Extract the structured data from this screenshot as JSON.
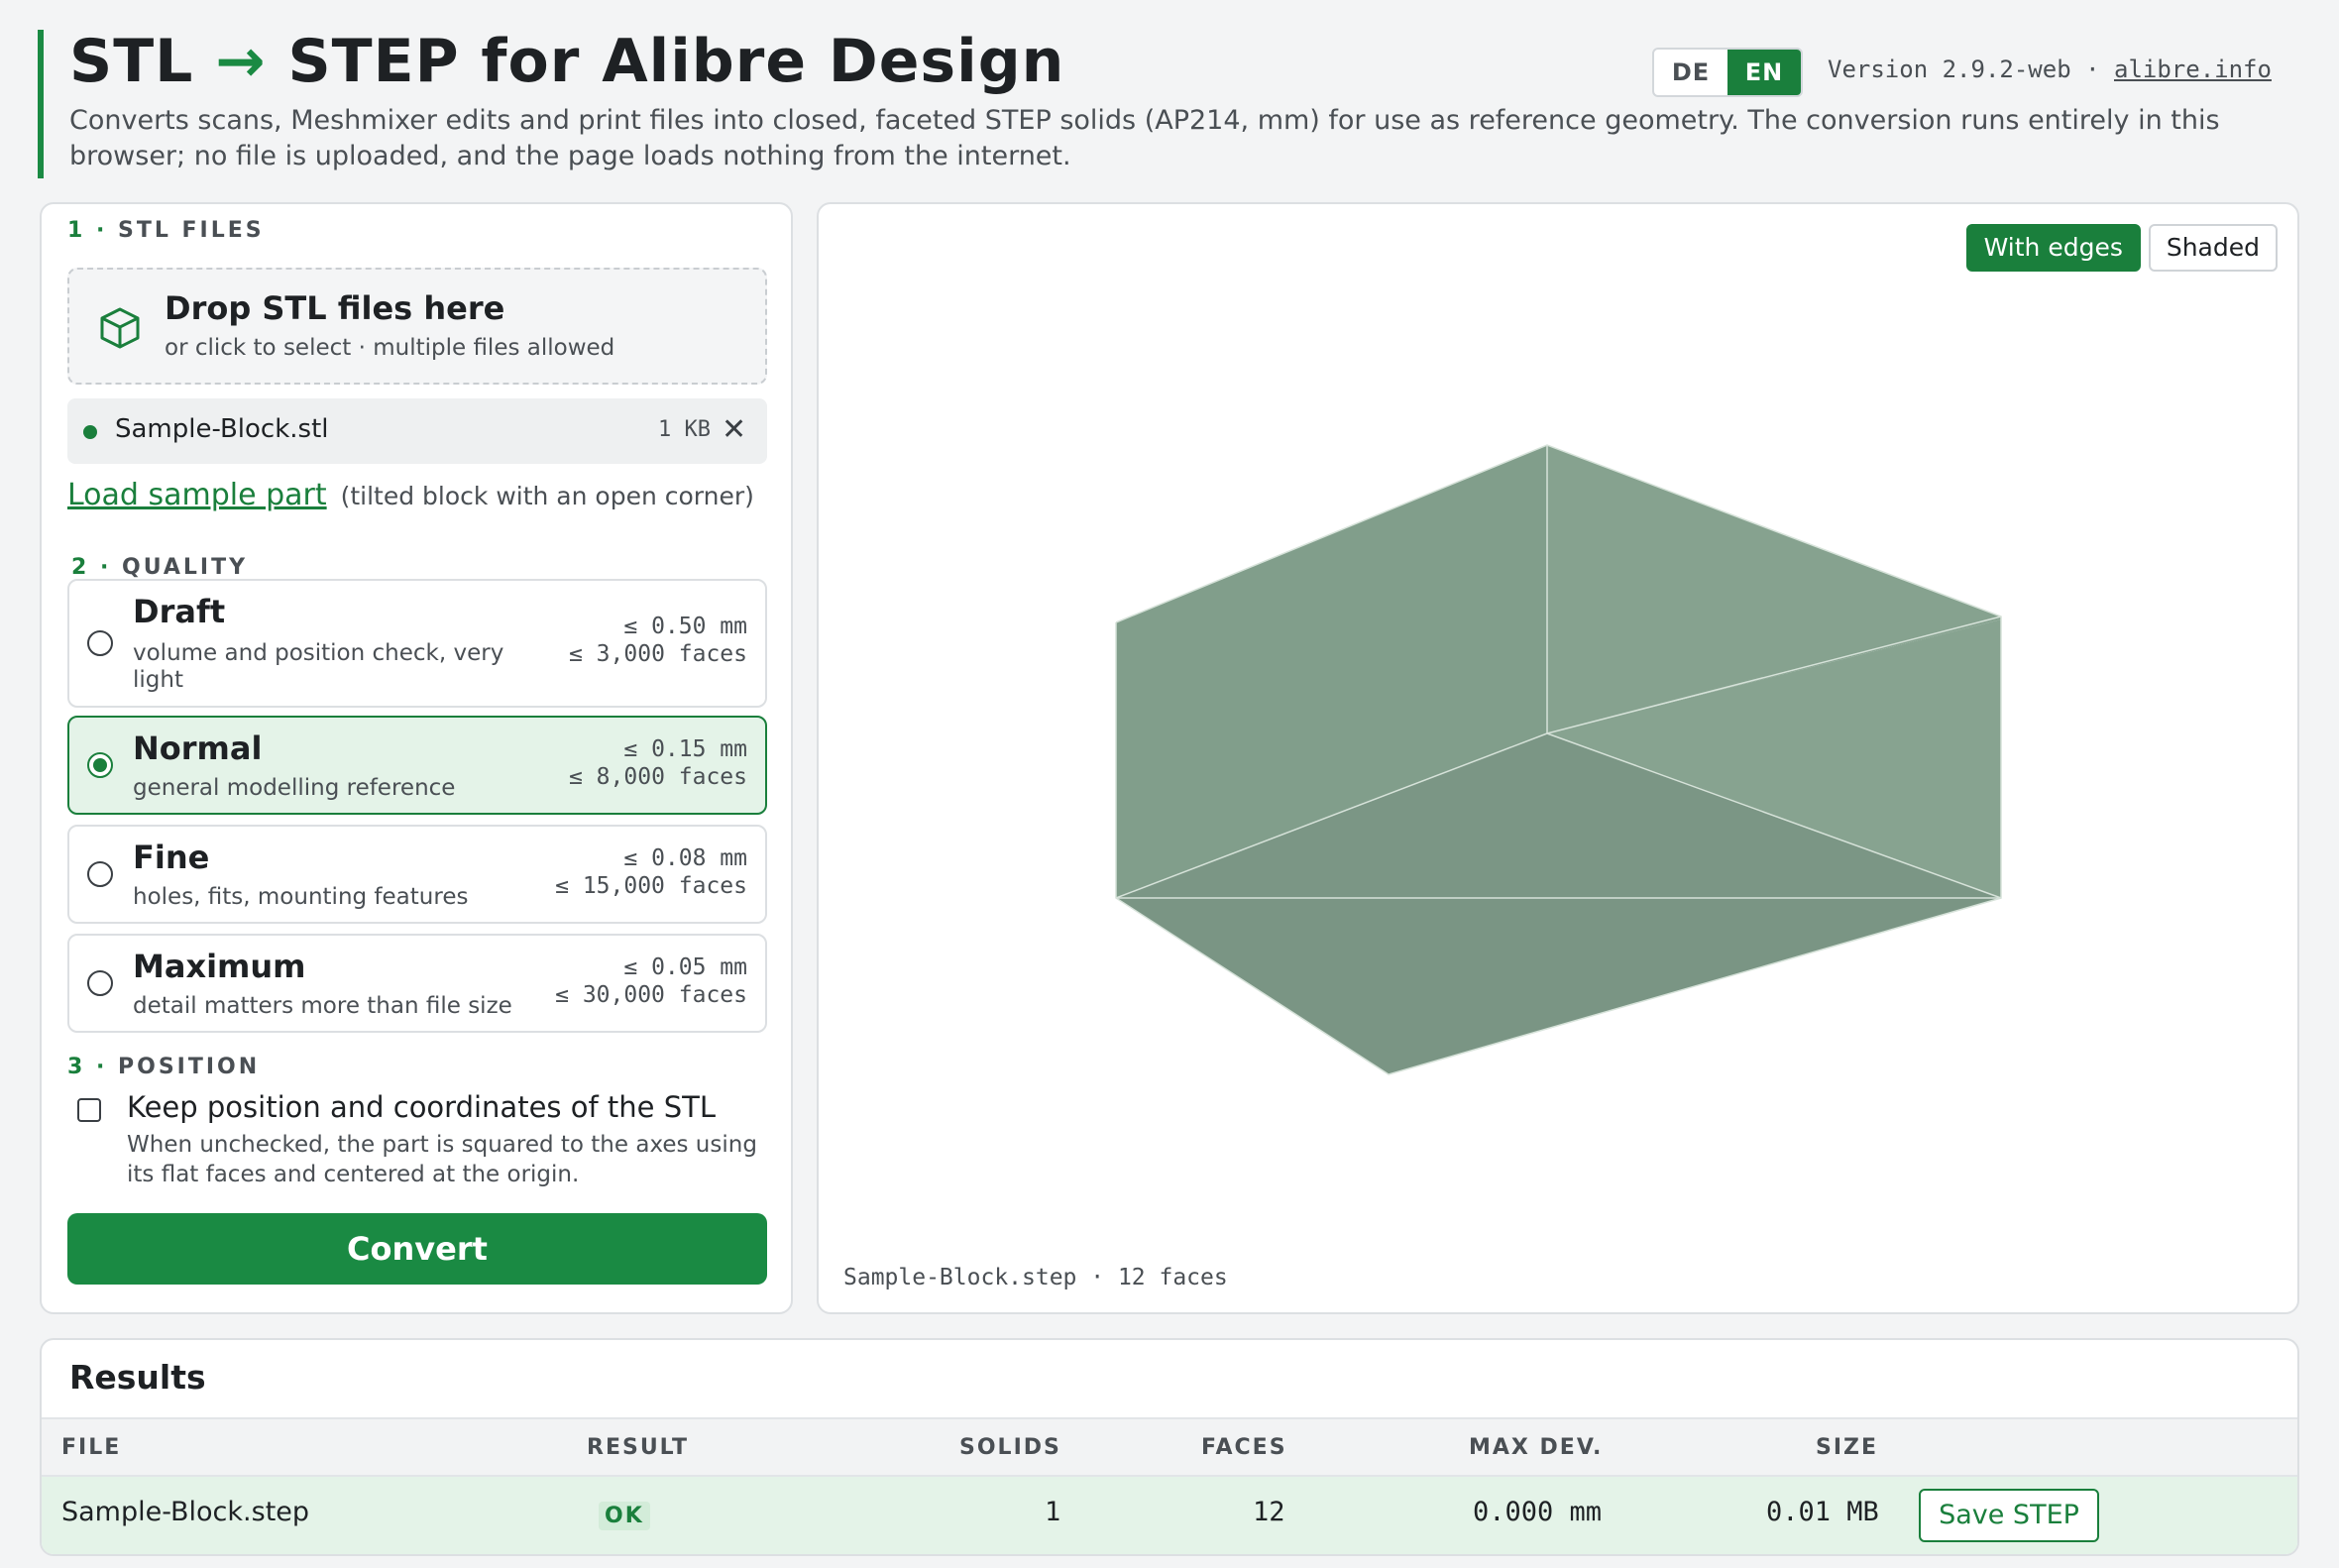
{
  "header": {
    "title_left": "STL",
    "title_arrow": "→",
    "title_right": "STEP for Alibre Design",
    "subtitle": "Converts scans, Meshmixer edits and print files into closed, faceted STEP solids (AP214, mm) for use as reference geometry. The conversion runs entirely in this browser; no file is uploaded, and the page loads nothing from the internet.",
    "lang_de": "DE",
    "lang_en": "EN",
    "version": "Version 2.9.2-web ·",
    "site_link": "alibre.info"
  },
  "files_section": {
    "num": "1 ·",
    "label": "STL FILES",
    "drop_title": "Drop STL files here",
    "drop_sub": "or click to select · multiple files allowed",
    "file": {
      "name": "Sample-Block.stl",
      "size": "1 KB",
      "remove": "✕"
    },
    "sample_link": "Load sample part",
    "sample_note": "(tilted block with an open corner)"
  },
  "quality_section": {
    "num": "2 ·",
    "label": "QUALITY",
    "options": [
      {
        "name": "Draft",
        "desc": "volume and position check, very light",
        "tol": "≤ 0.50 mm",
        "faces": "≤ 3,000 faces",
        "selected": false
      },
      {
        "name": "Normal",
        "desc": "general modelling reference",
        "tol": "≤ 0.15 mm",
        "faces": "≤ 8,000 faces",
        "selected": true
      },
      {
        "name": "Fine",
        "desc": "holes, fits, mounting features",
        "tol": "≤ 0.08 mm",
        "faces": "≤ 15,000 faces",
        "selected": false
      },
      {
        "name": "Maximum",
        "desc": "detail matters more than file size",
        "tol": "≤ 0.05 mm",
        "faces": "≤ 30,000 faces",
        "selected": false
      }
    ]
  },
  "position_section": {
    "num": "3 ·",
    "label": "POSITION",
    "checkbox_label": "Keep position and coordinates of the STL",
    "checked": false,
    "help": "When unchecked, the part is squared to the axes using its flat faces and centered at the origin."
  },
  "convert_label": "Convert",
  "viewer": {
    "btn_edges": "With edges",
    "btn_shaded": "Shaded",
    "active_mode": "With edges",
    "caption": "Sample-Block.step · 12 faces",
    "model_color": "#7f9d8a"
  },
  "results": {
    "title": "Results",
    "columns": [
      "FILE",
      "RESULT",
      "SOLIDS",
      "FACES",
      "MAX DEV.",
      "SIZE"
    ],
    "rows": [
      {
        "file": "Sample-Block.step",
        "result": "OK",
        "solids": "1",
        "faces": "12",
        "max_dev": "0.000 mm",
        "size": "0.01 MB",
        "action": "Save STEP"
      }
    ]
  },
  "colors": {
    "accent": "#1a7f3c",
    "selected_bg": "#e4f3e8",
    "page_bg": "#f3f4f5"
  }
}
